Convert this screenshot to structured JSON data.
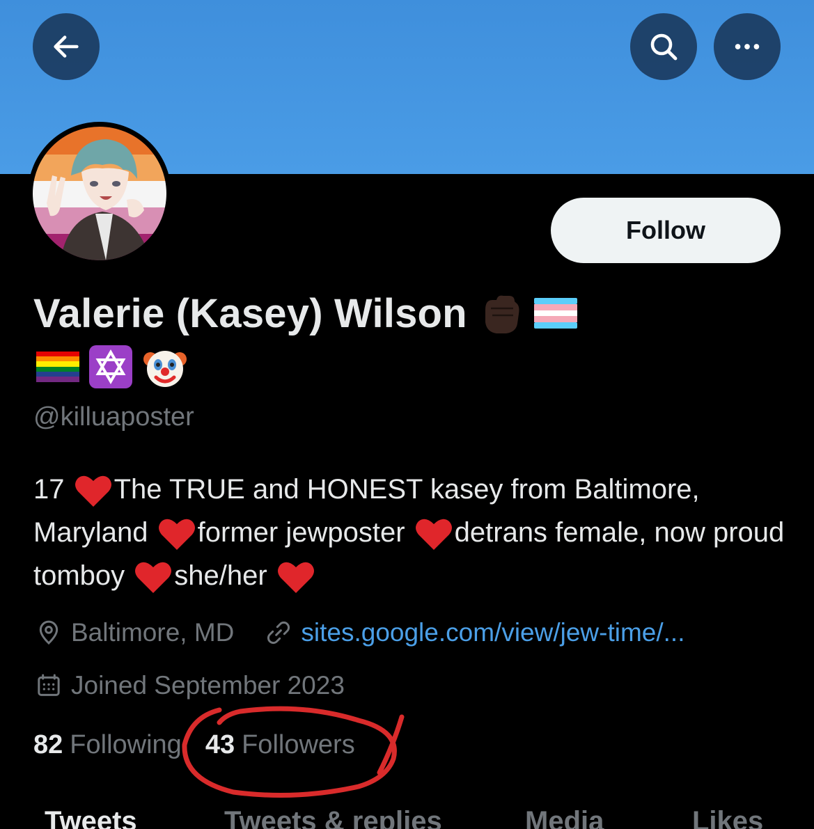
{
  "header": {
    "back_icon": "arrow-left-icon",
    "search_icon": "search-icon",
    "more_icon": "more-horizontal-icon",
    "banner_color": "#4a9ce6"
  },
  "profile": {
    "display_name": "Valerie (Kasey) Wilson",
    "name_emojis": [
      "raised-fist-dark-skin",
      "transgender-flag",
      "rainbow-flag",
      "star-of-david",
      "clown-face"
    ],
    "handle": "@killuaposter",
    "follow_label": "Follow",
    "bio": {
      "part1": "17",
      "part2": "The TRUE and HONEST kasey from Baltimore, Maryland",
      "part3": "former jewposter",
      "part4": "detrans female, now proud tomboy",
      "part5": "she/her"
    },
    "location": "Baltimore, MD",
    "website": "sites.google.com/view/jew-time/...",
    "joined": "Joined September 2023"
  },
  "stats": {
    "following_count": "82",
    "following_label": "Following",
    "followers_count": "43",
    "followers_label": "Followers"
  },
  "annotation": {
    "color": "#d92b2b"
  },
  "tabs": [
    {
      "label": "Tweets"
    },
    {
      "label": "Tweets & replies"
    },
    {
      "label": "Media"
    },
    {
      "label": "Likes"
    }
  ],
  "colors": {
    "text_primary": "#e7e9ea",
    "text_secondary": "#71767b",
    "link": "#4b9fe7",
    "background": "#000000"
  }
}
